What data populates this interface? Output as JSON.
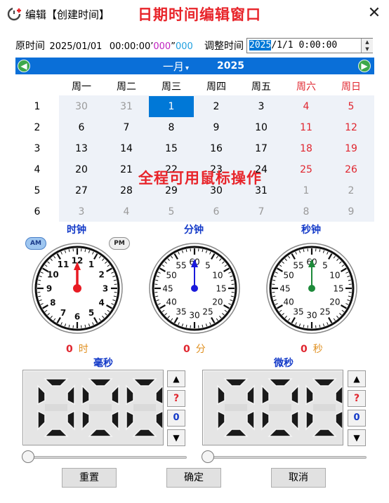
{
  "window": {
    "title": "编辑【创建时间】",
    "banner": "日期时间编辑窗口",
    "close_glyph": "✕"
  },
  "time_row": {
    "orig_label": "原时间",
    "orig_date": "2025/01/01",
    "orig_hms": "00:00:00",
    "orig_ms": "000",
    "orig_us": "000",
    "adjust_label": "调整时间",
    "adjust_value_year": "2025",
    "adjust_value_rest": "/1/1  0:00:00"
  },
  "calendar": {
    "month": "一月",
    "month_caret": "▾",
    "year": "2025",
    "weekdays": [
      "周一",
      "周二",
      "周三",
      "周四",
      "周五",
      "周六",
      "周日"
    ],
    "weeks": [
      "1",
      "2",
      "3",
      "4",
      "5",
      "6"
    ],
    "days": [
      [
        "30",
        "31",
        "1",
        "2",
        "3",
        "4",
        "5"
      ],
      [
        "6",
        "7",
        "8",
        "9",
        "10",
        "11",
        "12"
      ],
      [
        "13",
        "14",
        "15",
        "16",
        "17",
        "18",
        "19"
      ],
      [
        "20",
        "21",
        "22",
        "23",
        "24",
        "25",
        "26"
      ],
      [
        "27",
        "28",
        "29",
        "30",
        "31",
        "1",
        "2"
      ],
      [
        "3",
        "4",
        "5",
        "6",
        "7",
        "8",
        "9"
      ]
    ],
    "selected_day": "1",
    "overlay": "全程可用鼠标操作"
  },
  "clocks": {
    "hour": {
      "title": "时钟",
      "value": "0",
      "unit": "时",
      "am": "AM",
      "pm": "PM",
      "labels": [
        "12",
        "1",
        "2",
        "3",
        "4",
        "5",
        "6",
        "7",
        "8",
        "9",
        "10",
        "11"
      ]
    },
    "minute": {
      "title": "分钟",
      "value": "0",
      "unit": "分",
      "labels": [
        "60",
        "5",
        "10",
        "15",
        "20",
        "25",
        "30",
        "35",
        "40",
        "45",
        "50",
        "55"
      ]
    },
    "second": {
      "title": "秒钟",
      "value": "0",
      "unit": "秒",
      "labels": [
        "60",
        "5",
        "10",
        "15",
        "20",
        "25",
        "30",
        "35",
        "40",
        "45",
        "50",
        "55"
      ]
    }
  },
  "lcd": {
    "ms": {
      "title": "毫秒",
      "value": "000"
    },
    "us": {
      "title": "微秒",
      "value": "000"
    },
    "up": "▲",
    "down": "▼",
    "random": "?",
    "zero": "0"
  },
  "buttons": {
    "reset": "重置",
    "confirm": "确定",
    "cancel": "取消"
  },
  "colors": {
    "accent": "#0a6fd8",
    "selection": "#0078d7",
    "weekend": "#e0262f",
    "title_blue": "#1239c8",
    "hour_hand": "#e81b23",
    "minute_hand": "#1a1adb",
    "second_hand": "#1d8a3a"
  }
}
